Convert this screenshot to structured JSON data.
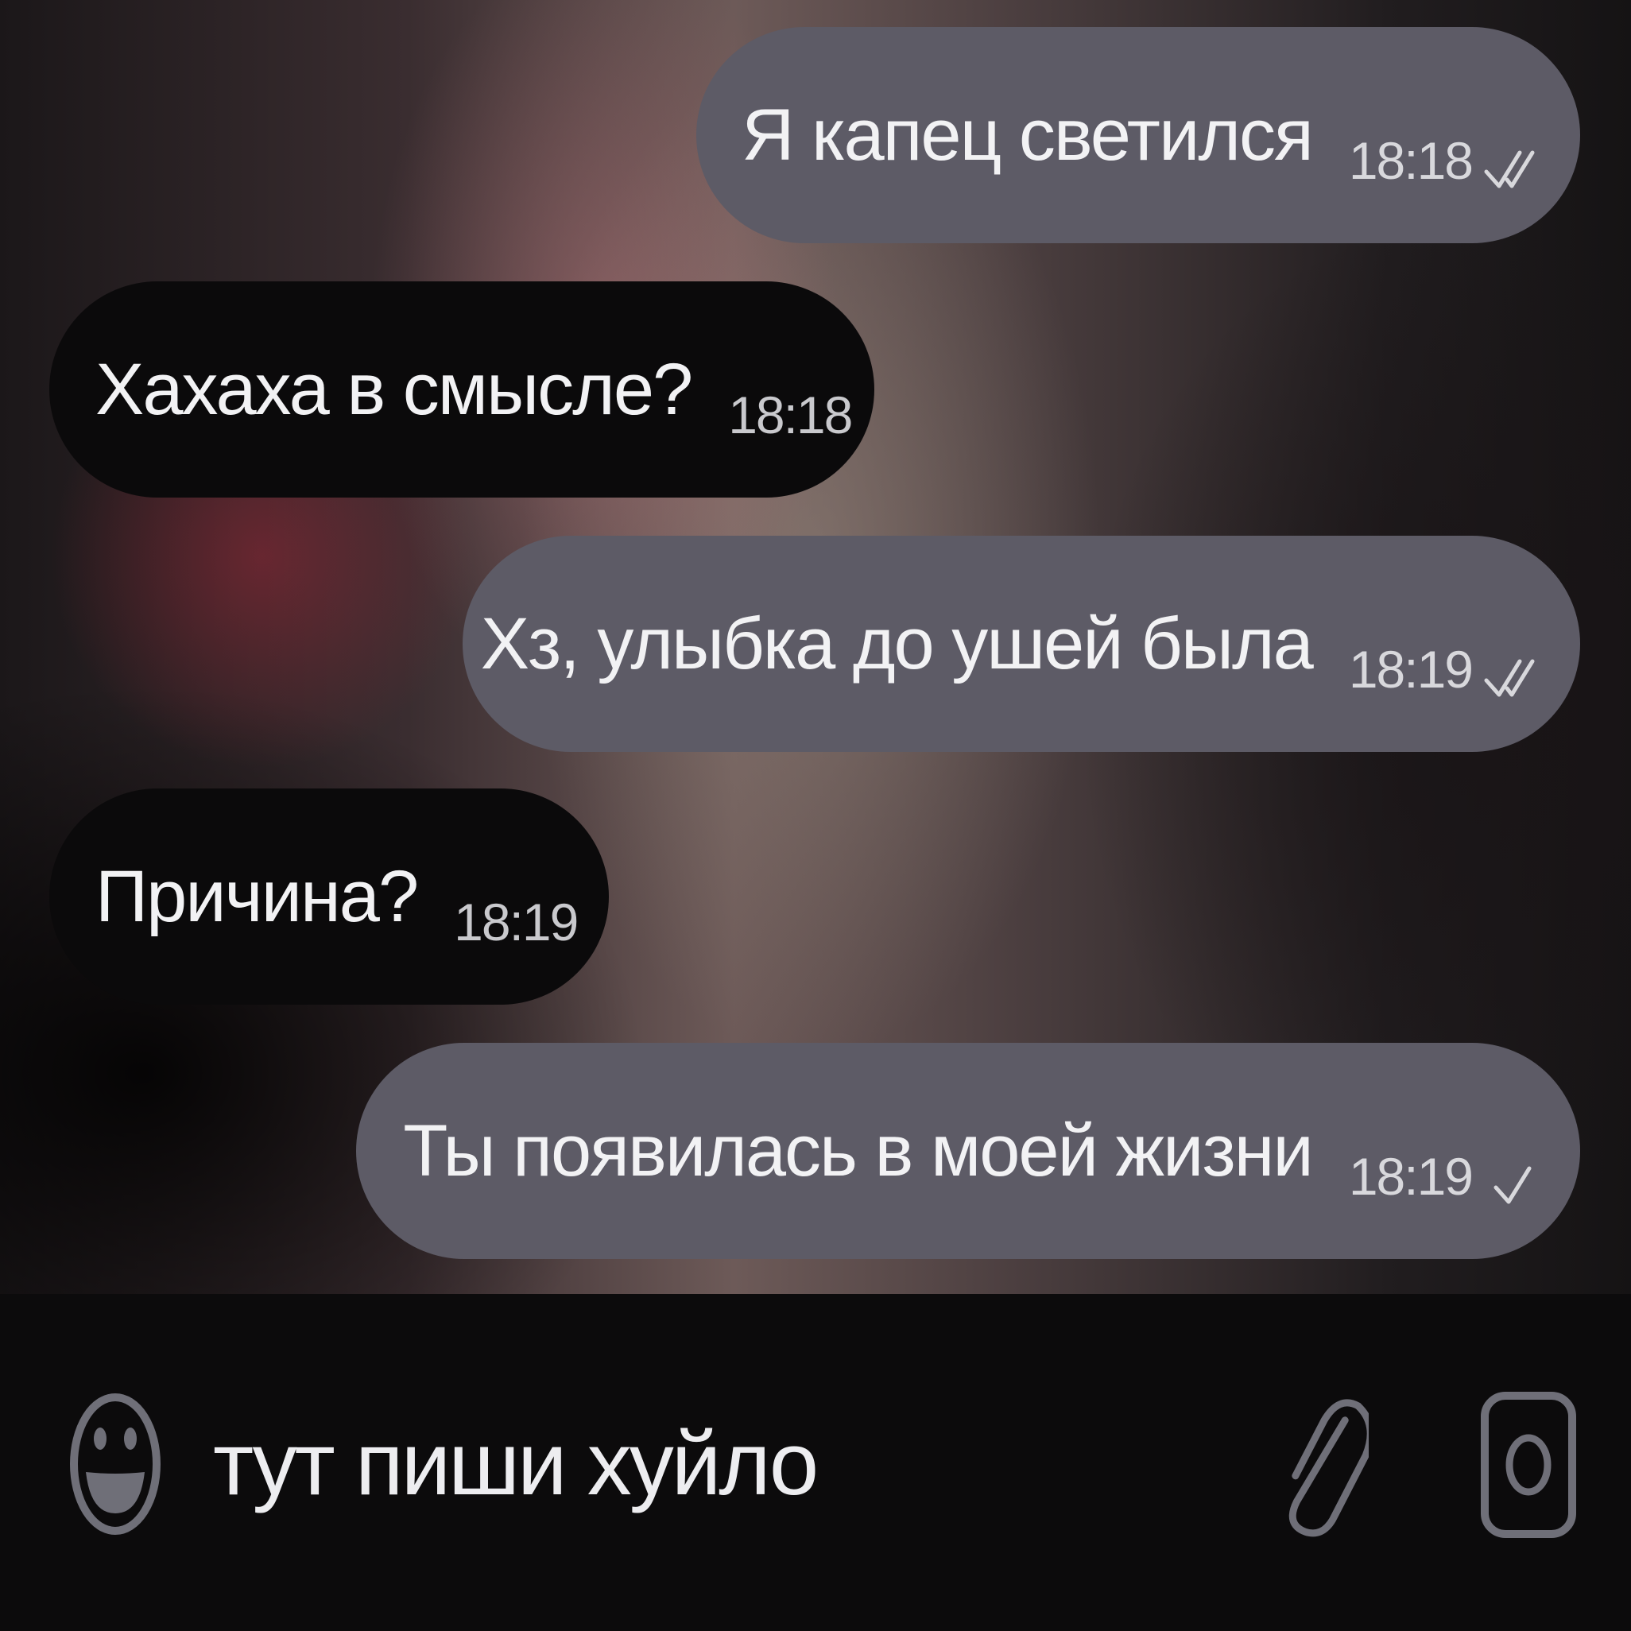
{
  "messages": [
    {
      "direction": "out",
      "text": "Я капец светился",
      "time": "18:18",
      "status": "read"
    },
    {
      "direction": "in",
      "text": "Хахаха в смысле?",
      "time": "18:18"
    },
    {
      "direction": "out",
      "text": "Хз, улыбка до ушей была",
      "time": "18:19",
      "status": "read"
    },
    {
      "direction": "in",
      "text": "Причина?",
      "time": "18:19"
    },
    {
      "direction": "out",
      "text": "Ты появилась в моей жизни",
      "time": "18:19",
      "status": "sent"
    }
  ],
  "composer": {
    "text": "тут пиши хуйло",
    "emoji_icon": "smiley-face-icon",
    "attach_icon": "paperclip-icon",
    "camera_icon": "camera-icon"
  },
  "colors": {
    "outgoing_bubble": "#5d5b66",
    "incoming_bubble": "#0b0a0b",
    "input_bar": "#0c0b0c",
    "text": "#f2f2f4"
  }
}
